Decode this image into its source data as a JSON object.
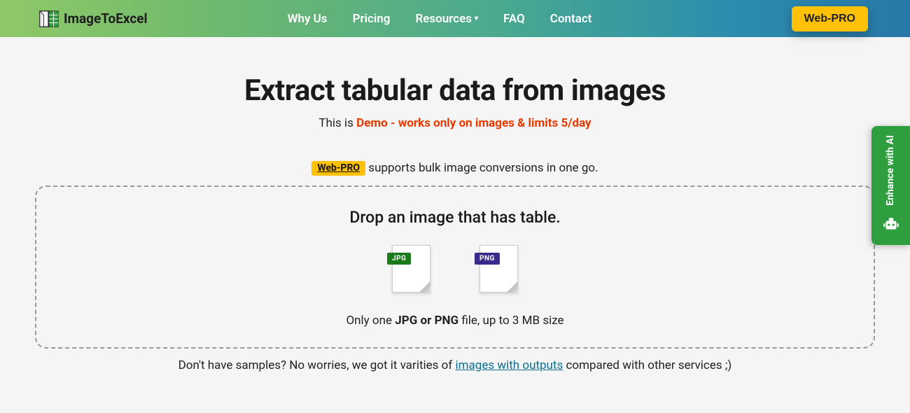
{
  "brand": {
    "name": "ImageToExcel"
  },
  "nav": {
    "why": "Why Us",
    "pricing": "Pricing",
    "resources": "Resources",
    "faq": "FAQ",
    "contact": "Contact"
  },
  "cta": {
    "webpro": "Web-PRO"
  },
  "hero": {
    "title": "Extract tabular data from images",
    "subline_prefix": "This is ",
    "subline_highlight": "Demo - works only on images & limits 5/day"
  },
  "proline": {
    "badge": "Web-PRO",
    "text": " supports bulk image conversions in one go."
  },
  "dropzone": {
    "title": "Drop an image that has table.",
    "jpg_label": "JPG",
    "png_label": "PNG",
    "limit_prefix": "Only one ",
    "limit_strong": "JPG or PNG",
    "limit_suffix": " file, up to 3 MB size"
  },
  "samples": {
    "prefix": "Don't have samples? No worries, we got it varities of ",
    "link": "images with outputs",
    "suffix": " compared with other services ;)"
  },
  "enhance": {
    "label": "Enhance\nwith AI"
  }
}
